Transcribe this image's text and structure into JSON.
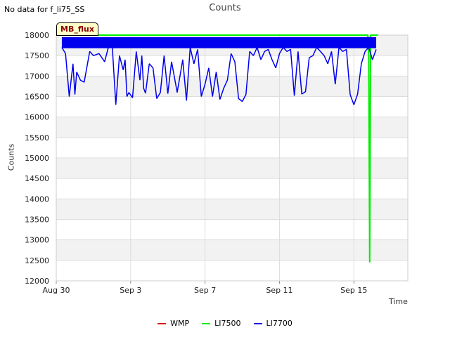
{
  "header": {
    "no_data_text": "No data for f_li75_SS",
    "badge": "MB_flux"
  },
  "colors": {
    "WMP": "#dd0000",
    "LI7500": "#00ee00",
    "LI7700": "#0000ee",
    "band": "#f2f2f2",
    "grid": "#dddddd"
  },
  "chart_data": {
    "type": "line",
    "title": "Counts",
    "xlabel": "Time",
    "ylabel": "Counts",
    "ylim": [
      12000,
      18000
    ],
    "yticks": [
      12000,
      12500,
      13000,
      13500,
      14000,
      14500,
      15000,
      15500,
      16000,
      16500,
      17000,
      17500,
      18000
    ],
    "xlim": [
      0,
      18.9
    ],
    "xticks": [
      {
        "value": 0,
        "label": "Aug 30"
      },
      {
        "value": 4,
        "label": "Sep 3"
      },
      {
        "value": 8,
        "label": "Sep 7"
      },
      {
        "value": 12,
        "label": "Sep 11"
      },
      {
        "value": 16,
        "label": "Sep 15"
      }
    ],
    "grid": true,
    "legend_position": "bottom",
    "series": [
      {
        "name": "WMP",
        "x": [],
        "y": []
      },
      {
        "name": "LI7500",
        "x": [
          0.3,
          16.75,
          16.8,
          16.85,
          16.9,
          17.3
        ],
        "y": [
          18000,
          18000,
          17500,
          12450,
          18000,
          18000
        ]
      },
      {
        "name": "LI7700",
        "x": [
          0.3,
          0.5,
          0.7,
          0.9,
          1.0,
          1.1,
          1.3,
          1.5,
          1.8,
          2.0,
          2.3,
          2.6,
          2.8,
          3.0,
          3.2,
          3.4,
          3.6,
          3.7,
          3.8,
          3.9,
          4.1,
          4.3,
          4.5,
          4.6,
          4.7,
          4.8,
          5.0,
          5.2,
          5.4,
          5.6,
          5.8,
          6.0,
          6.2,
          6.3,
          6.5,
          6.8,
          7.0,
          7.2,
          7.4,
          7.6,
          7.8,
          8.0,
          8.2,
          8.4,
          8.6,
          8.8,
          9.0,
          9.2,
          9.4,
          9.6,
          9.8,
          10.0,
          10.2,
          10.4,
          10.6,
          10.8,
          11.0,
          11.2,
          11.4,
          11.6,
          11.8,
          12.0,
          12.2,
          12.4,
          12.6,
          12.8,
          13.0,
          13.2,
          13.4,
          13.6,
          13.8,
          14.0,
          14.2,
          14.4,
          14.6,
          14.8,
          15.0,
          15.2,
          15.4,
          15.6,
          15.8,
          16.0,
          16.2,
          16.4,
          16.6,
          16.8,
          17.0,
          17.2
        ],
        "y": [
          17700,
          17550,
          16500,
          17300,
          16550,
          17100,
          16900,
          16850,
          17600,
          17500,
          17550,
          17350,
          17700,
          17800,
          16300,
          17500,
          17150,
          17400,
          16500,
          16600,
          16470,
          17600,
          16900,
          17500,
          16700,
          16580,
          17300,
          17200,
          16450,
          16600,
          17500,
          16570,
          17350,
          17100,
          16600,
          17400,
          16400,
          17700,
          17300,
          17650,
          16500,
          16800,
          17200,
          16500,
          17100,
          16430,
          16700,
          16900,
          17550,
          17350,
          16450,
          16380,
          16550,
          17600,
          17500,
          17700,
          17400,
          17600,
          17650,
          17400,
          17200,
          17550,
          17700,
          17600,
          17650,
          16520,
          17600,
          16560,
          16620,
          17450,
          17500,
          17700,
          17600,
          17500,
          17300,
          17600,
          16800,
          17700,
          17600,
          17650,
          16550,
          16300,
          16560,
          17300,
          17600,
          17700,
          17400,
          17650
        ]
      }
    ]
  }
}
